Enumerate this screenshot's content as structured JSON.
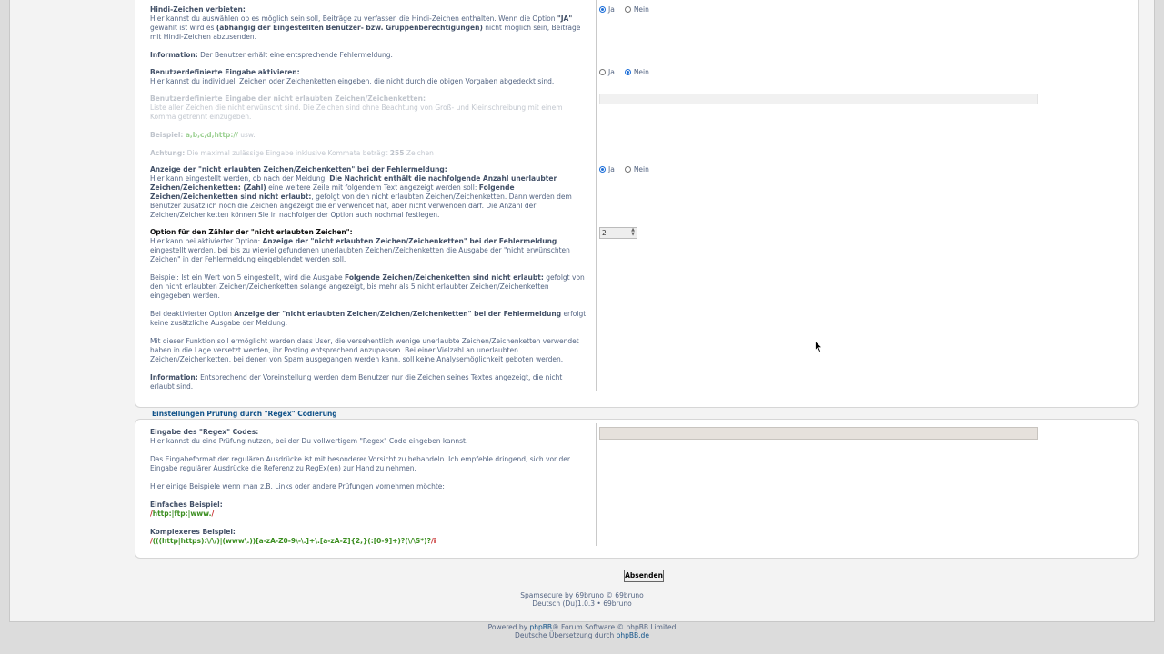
{
  "section1": {
    "hindi": {
      "title": "Hindi-Zeichen verbieten:",
      "t1": "Hier kannst du auswählen ob es möglich sein soll, Beiträge zu verfassen die Hindi-Zeichen enthalten. Wenn die Option ",
      "b1": "\"JA\"",
      "t2": " gewählt ist wird es ",
      "b2": "(abhängig der Eingestellten Benutzer- bzw. Gruppenberechtigungen)",
      "t3": " nicht möglich sein, Beiträge mit Hindi-Zeichen abzusenden.",
      "info_label": "Information:",
      "info_text": " Der Benutzer erhält eine entsprechende Fehlermeldung.",
      "option_yes": "Ja",
      "option_no": "Nein",
      "selected": "Ja"
    },
    "custom": {
      "title": "Benutzerdefinierte Eingabe aktivieren:",
      "desc": "Hier kannst du individuell Zeichen oder Zeichenketten eingeben, die nicht durch die obigen Vorgaben abgedeckt sind.",
      "option_yes": "Ja",
      "option_no": "Nein",
      "selected": "Nein"
    },
    "custom_chars": {
      "title": "Benutzerdefinierte Eingabe der nicht erlaubten Zeichen/Zeichenketten:",
      "desc": "Liste aller Zeichen die nicht erwünscht sind. Die Zeichen sind ohne Beachtung von Groß- und Kleinschreibung mit einem Komma getrennt einzugeben.",
      "example_label": "Beispiel:",
      "example_value": "a,b,c,d,http://",
      "example_suffix": " usw.",
      "warn_label": "Achtung:",
      "warn_text1": " Die maximal zulässige Eingabe inklusive Kommata beträgt ",
      "warn_num": "255",
      "warn_text2": " Zeichen",
      "value": ""
    },
    "display": {
      "title": "Anzeige der \"nicht erlaubten Zeichen/Zeichenketten\" bei der Fehlermeldung:",
      "t1": "Hier kann eingestellt werden, ob nach der Meldung: ",
      "b1": "Die Nachricht enthält die nachfolgende Anzahl unerlaubter Zeichen/Zeichenketten: (Zahl)",
      "t2": " eine weitere Zeile mit folgendem Text angezeigt werden soll: ",
      "b2": "Folgende Zeichen/Zeichenketten sind nicht erlaubt:",
      "t3": ", gefolgt von den nicht erlaubten Zeichen/Zeichenketten. Dann werden dem Benutzer zusätzlich noch die Zeichen angezeigt die er verwendet hat, aber nicht verwenden darf. Die Anzahl der Zeichen/Zeichenketten können Sie in nachfolgender Option auch nochmal festlegen.",
      "option_yes": "Ja",
      "option_no": "Nein",
      "selected": "Ja"
    },
    "counter": {
      "title": "Option für den Zähler der \"nicht erlaubten Zeichen\":",
      "p1a": "Hier kann bei aktivierter Option: ",
      "p1b": "Anzeige der \"nicht erlaubten Zeichen/Zeichenketten\" bei der Fehlermeldung",
      "p1c": " eingestellt werden, bei bis zu wieviel gefundenen unerlaubten Zeichen/Zeichenketten die Ausgabe der \"nicht erwünschten Zeichen\" in der Fehlermeldung eingeblendet werden soll.",
      "p2a": "Beispiel: Ist ein Wert von 5 eingestellt, wird die Ausgabe ",
      "p2b": "Folgende Zeichen/Zeichenketten sind nicht erlaubt:",
      "p2c": " gefolgt von den nicht erlaubten Zeichen/Zeichenketten solange angezeigt, bis mehr als 5 nicht erlaubter Zeichen/Zeichenketten eingegeben werden.",
      "p3a": "Bei deaktivierter Option ",
      "p3b": "Anzeige der \"nicht erlaubten Zeichen/Zeichen/Zeichenketten\" bei der Fehlermeldung",
      "p3c": " erfolgt keine zusätzliche Ausgabe der Meldung.",
      "p4": "Mit dieser Funktion soll ermöglicht werden dass User, die versehentlich wenige unerlaubte Zeichen/Zeichenketten verwendet haben in die Lage versetzt werden, ihr Posting entsprechend anzupassen. Bei einer Vielzahl an unerlaubten Zeichen/Zeichenketten, bei denen von Spam ausgegangen werden kann, soll keine Analysemöglichkeit geboten werden.",
      "info_label": "Information:",
      "info_text": " Entsprechend der Voreinstellung werden dem Benutzer nur die Zeichen seines Textes angezeigt, die nicht erlaubt sind.",
      "value": "2"
    }
  },
  "section2": {
    "legend": "Einstellungen Prüfung durch \"Regex\" Codierung",
    "title": "Eingabe des \"Regex\" Codes:",
    "desc": "Hier kannst du eine Prüfung nutzen, bei der Du vollwertigem \"Regex\" Code eingeben kannst.",
    "p2": "Das Eingabeformat der regulären Ausdrücke ist mit besonderer Vorsicht zu behandeln. Ich empfehle dringend, sich vor der Eingabe regulärer Ausdrücke die Referenz zu RegEx(en) zur Hand zu nehmen.",
    "p3": "Hier einige Beispiele wenn man z.B. Links oder andere Prüfungen vornehmen möchte:",
    "simple_label": "Einfaches Beispiel:",
    "simple_d1": "/",
    "simple_mid": "http:|ftp:|www.",
    "simple_d2": "/",
    "complex_label": "Komplexeres Beispiel:",
    "complex_d1": "/",
    "complex_mid": "(((http|https):\\/\\/)|(www\\.))[a-zA-Z0-9\\-\\.]+\\.[a-zA-Z]{2,}(:[0-9]+)?(\\/\\S*)?",
    "complex_d2": "/i",
    "value": ""
  },
  "submit_label": "Absenden",
  "footer": {
    "line1": "Spamsecure by 69bruno © 69bruno",
    "line2": "Deutsch (Du)1.0.3 • 69bruno",
    "powered_pre": "Powered by ",
    "powered_link": "phpBB",
    "powered_post": "® Forum Software © phpBB Limited",
    "translation_pre": "Deutsche Übersetzung durch ",
    "translation_link": "phpBB.de"
  }
}
